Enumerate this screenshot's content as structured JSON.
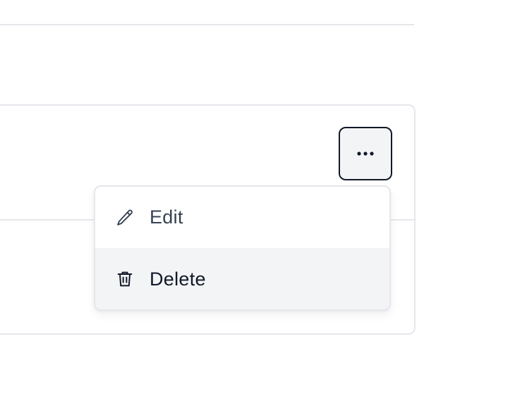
{
  "more_button": {
    "icon": "ellipsis-horizontal-icon"
  },
  "menu": {
    "items": [
      {
        "label": "Edit",
        "icon": "pencil-icon",
        "highlighted": false
      },
      {
        "label": "Delete",
        "icon": "trash-icon",
        "highlighted": true
      }
    ]
  },
  "colors": {
    "border": "#e5e7eb",
    "highlight_bg": "#f3f4f6",
    "text_primary": "#111827",
    "text_secondary": "#374151"
  }
}
